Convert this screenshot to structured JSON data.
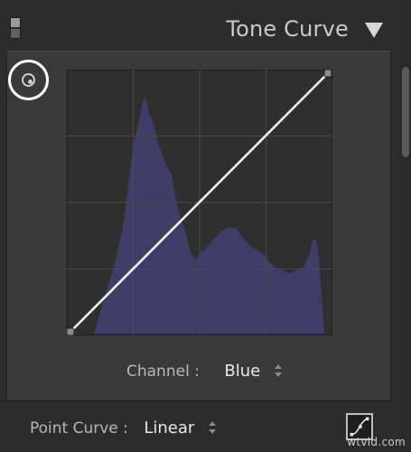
{
  "panel": {
    "title": "Tone Curve"
  },
  "channel": {
    "label": "Channel :",
    "value": "Blue"
  },
  "point_curve": {
    "label": "Point Curve :",
    "value": "Linear"
  },
  "colors": {
    "histogram": "#3d3d67",
    "curve_line": "#ffffff",
    "grid": "#4a4a4a",
    "plot_bg": "#2f2f2f"
  },
  "icons": {
    "panel_toggle": "toggle-switch-icon",
    "collapse": "triangle-down-icon",
    "targeted_adjustment": "target-adjustment-icon",
    "edit_curve": "edit-curve-icon",
    "channel_stepper": "updown-stepper-icon",
    "point_curve_stepper": "updown-stepper-icon"
  },
  "watermark": {
    "text": "wtvid.com"
  }
}
